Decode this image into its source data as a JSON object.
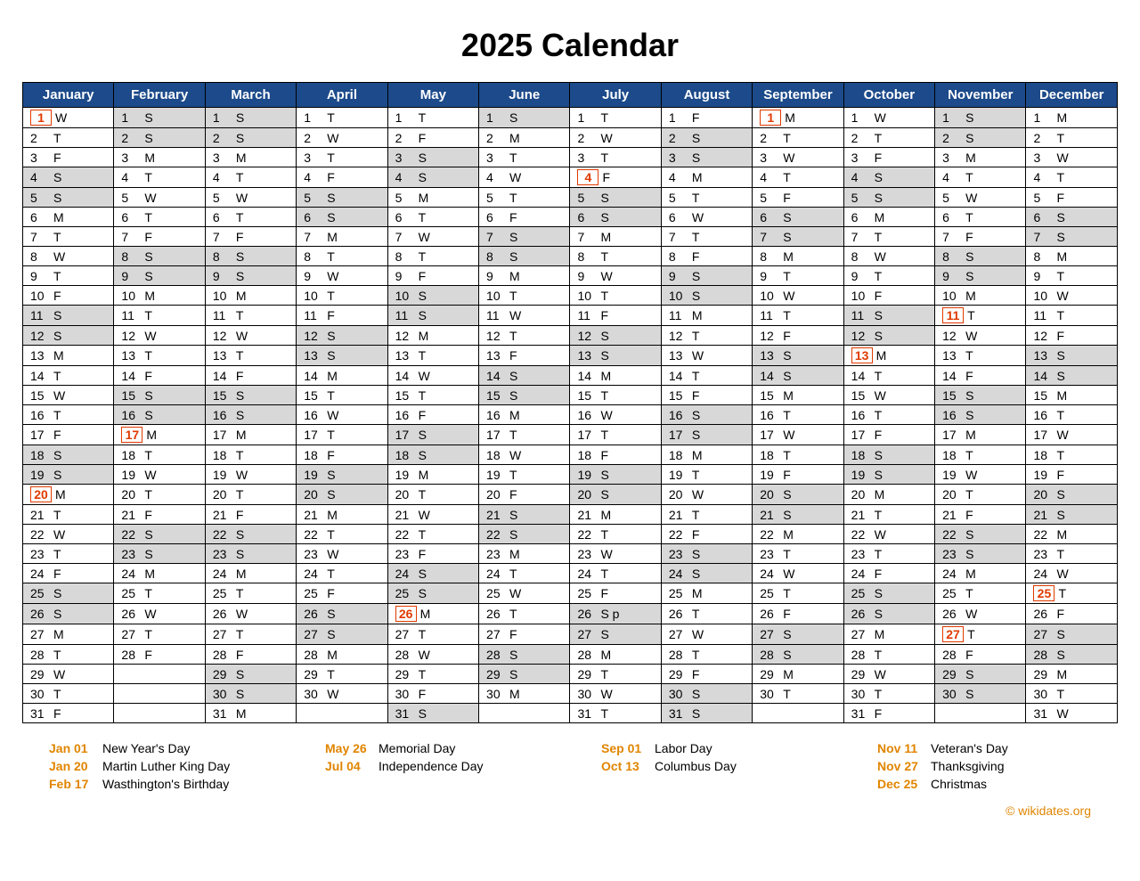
{
  "title": "2025 Calendar",
  "months": [
    "January",
    "February",
    "March",
    "April",
    "May",
    "June",
    "July",
    "August",
    "September",
    "October",
    "November",
    "December"
  ],
  "start_dow": [
    3,
    6,
    6,
    2,
    4,
    0,
    2,
    5,
    1,
    3,
    6,
    1
  ],
  "days_in_month": [
    31,
    28,
    31,
    30,
    31,
    30,
    31,
    31,
    30,
    31,
    30,
    31
  ],
  "dow_letters": [
    "S",
    "M",
    "T",
    "W",
    "T",
    "F",
    "S"
  ],
  "weekend_dows": [
    0,
    6
  ],
  "holidays": {
    "0": [
      1,
      20
    ],
    "1": [
      17
    ],
    "4": [
      26
    ],
    "6": [
      4
    ],
    "8": [
      1
    ],
    "9": [
      13
    ],
    "10": [
      11,
      27
    ],
    "11": [
      25
    ]
  },
  "holiday_list": [
    [
      {
        "date": "Jan 01",
        "name": "New Year's Day"
      },
      {
        "date": "Jan 20",
        "name": "Martin Luther King Day"
      },
      {
        "date": "Feb 17",
        "name": "Wasthington's Birthday"
      }
    ],
    [
      {
        "date": "May 26",
        "name": "Memorial Day"
      },
      {
        "date": "Jul 04",
        "name": "Independence Day"
      }
    ],
    [
      {
        "date": "Sep 01",
        "name": "Labor Day"
      },
      {
        "date": "Oct 13",
        "name": "Columbus Day"
      }
    ],
    [
      {
        "date": "Nov 11",
        "name": "Veteran's Day"
      },
      {
        "date": "Nov 27",
        "name": "Thanksgiving"
      },
      {
        "date": "Dec 25",
        "name": "Christmas"
      }
    ]
  ],
  "special_cell": {
    "month": 6,
    "day": 26,
    "extra": "p"
  },
  "copyright": "© wikidates.org"
}
